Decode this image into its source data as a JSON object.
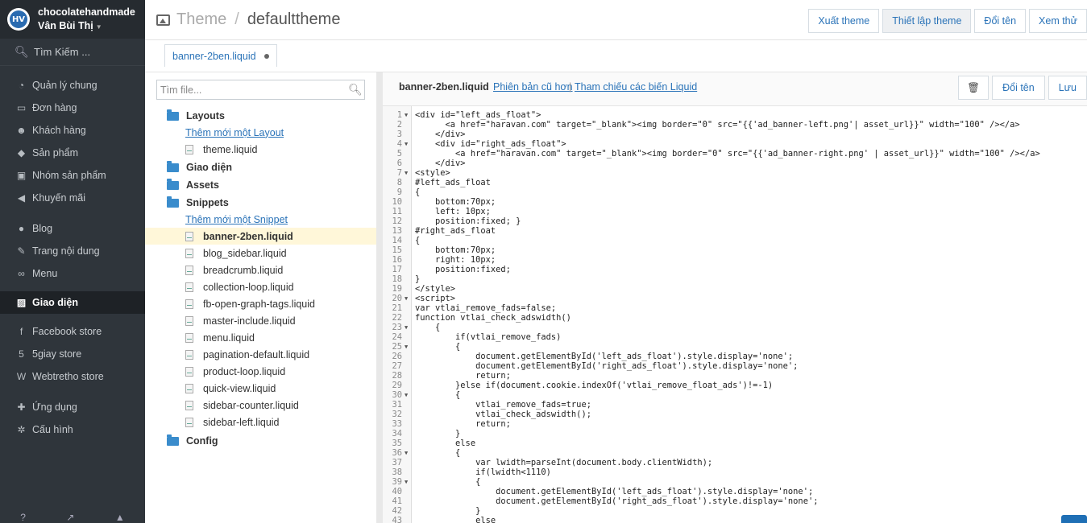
{
  "sidebar": {
    "shop_name": "chocolatehandmade",
    "user_name": "Vân Bùi Thị",
    "logo_text": "HV",
    "search_label": "Tìm Kiếm ...",
    "items": [
      {
        "label": "Quản lý chung",
        "icon": "dashboard-icon"
      },
      {
        "label": "Đơn hàng",
        "icon": "inbox-icon"
      },
      {
        "label": "Khách hàng",
        "icon": "users-icon"
      },
      {
        "label": "Sản phẩm",
        "icon": "tag-icon"
      },
      {
        "label": "Nhóm sản phẩm",
        "icon": "briefcase-icon"
      },
      {
        "label": "Khuyến mãi",
        "icon": "bullhorn-icon"
      },
      {
        "label": "Blog",
        "icon": "comment-icon"
      },
      {
        "label": "Trang nội dung",
        "icon": "edit-icon"
      },
      {
        "label": "Menu",
        "icon": "link-icon"
      },
      {
        "label": "Giao diện",
        "icon": "image-icon"
      },
      {
        "label": "Facebook store",
        "icon": "facebook-icon"
      },
      {
        "label": "5giay store",
        "icon": "five-icon"
      },
      {
        "label": "Webtretho store",
        "icon": "w-icon"
      },
      {
        "label": "Ứng dụng",
        "icon": "puzzle-icon"
      },
      {
        "label": "Cấu hình",
        "icon": "gear-icon"
      }
    ]
  },
  "header": {
    "section": "Theme",
    "separator": "/",
    "current": "defaulttheme",
    "actions": [
      "Xuất theme",
      "Thiết lập theme",
      "Đổi tên",
      "Xem thử"
    ]
  },
  "tab": {
    "label": "banner-2ben.liquid"
  },
  "tree": {
    "search_placeholder": "Tìm file...",
    "folders": {
      "layouts": "Layouts",
      "layouts_add": "Thêm mới một Layout",
      "layouts_files": [
        "theme.liquid"
      ],
      "giaodien": "Giao diện",
      "assets": "Assets",
      "snippets": "Snippets",
      "snippets_add": "Thêm mới một Snippet",
      "snippets_files": [
        "banner-2ben.liquid",
        "blog_sidebar.liquid",
        "breadcrumb.liquid",
        "collection-loop.liquid",
        "fb-open-graph-tags.liquid",
        "master-include.liquid",
        "menu.liquid",
        "pagination-default.liquid",
        "product-loop.liquid",
        "quick-view.liquid",
        "sidebar-counter.liquid",
        "sidebar-left.liquid"
      ],
      "config": "Config"
    }
  },
  "editor": {
    "file_title": "banner-2ben.liquid",
    "old_versions": "Phiên bản cũ hơn",
    "sep": "|",
    "liquid_ref": "Tham chiếu các biến Liquid",
    "rename": "Đổi tên",
    "save": "Lưu",
    "lines": [
      "<div id=\"left_ads_float\">",
      "      <a href=\"haravan.com\" target=\"_blank\"><img border=\"0\" src=\"{{'ad_banner-left.png'| asset_url}}\" width=\"100\" /></a>",
      "    </div>",
      "    <div id=\"right_ads_float\">",
      "        <a href=\"haravan.com\" target=\"_blank\"><img border=\"0\" src=\"{{'ad_banner-right.png' | asset_url}}\" width=\"100\" /></a>",
      "    </div>",
      "<style>",
      "#left_ads_float",
      "{",
      "    bottom:70px;",
      "    left: 10px;",
      "    position:fixed; }",
      "#right_ads_float",
      "{",
      "    bottom:70px;",
      "    right: 10px;",
      "    position:fixed;",
      "}",
      "</style>",
      "<script>",
      "var vtlai_remove_fads=false;",
      "function vtlai_check_adswidth()",
      "    {",
      "        if(vtlai_remove_fads)",
      "        {",
      "            document.getElementById('left_ads_float').style.display='none';",
      "            document.getElementById('right_ads_float').style.display='none';",
      "            return;",
      "        }else if(document.cookie.indexOf('vtlai_remove_float_ads')!=-1)",
      "        {",
      "            vtlai_remove_fads=true;",
      "            vtlai_check_adswidth();",
      "            return;",
      "        }",
      "        else",
      "        {",
      "            var lwidth=parseInt(document.body.clientWidth);",
      "            if(lwidth<1110)",
      "            {",
      "                document.getElementById('left_ads_float').style.display='none';",
      "                document.getElementById('right_ads_float').style.display='none';",
      "            }",
      "            else"
    ],
    "folds": [
      1,
      4,
      7,
      20,
      23,
      25,
      30,
      36,
      39
    ]
  }
}
